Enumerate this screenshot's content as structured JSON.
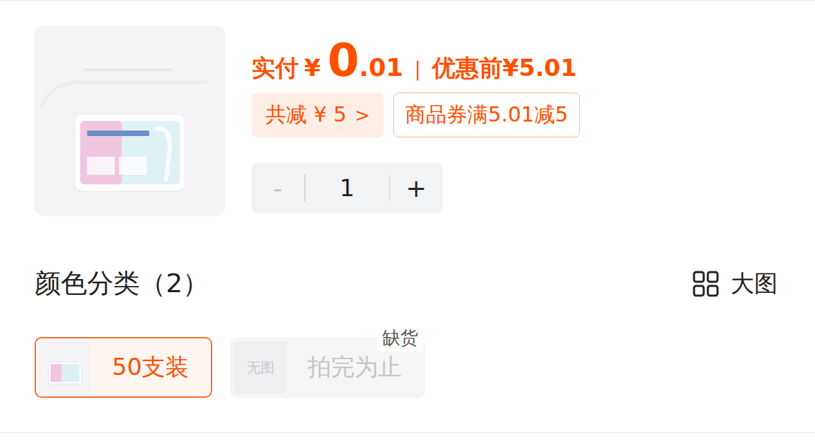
{
  "product": {
    "image": "dental-flosser-box"
  },
  "price": {
    "paid_label": "实付",
    "currency": "¥",
    "integer": "0",
    "decimal": ".01",
    "separator": "|",
    "original_label": "优惠前",
    "original_price": "¥5.01"
  },
  "discount": {
    "total": "共减 ¥ 5",
    "arrow": ">"
  },
  "coupon": "商品券满5.01减5",
  "quantity": {
    "minus": "-",
    "value": "1",
    "plus": "+",
    "minus_disabled": true
  },
  "section": {
    "title": "颜色分类（2）",
    "view_toggle": "大图"
  },
  "options": [
    {
      "label": "50支装",
      "kind": "image",
      "selected": true,
      "disabled": false
    },
    {
      "label": "拍完为止",
      "kind": "no-image",
      "placeholder": "无图",
      "badge": "缺货",
      "selected": false,
      "disabled": true
    }
  ]
}
